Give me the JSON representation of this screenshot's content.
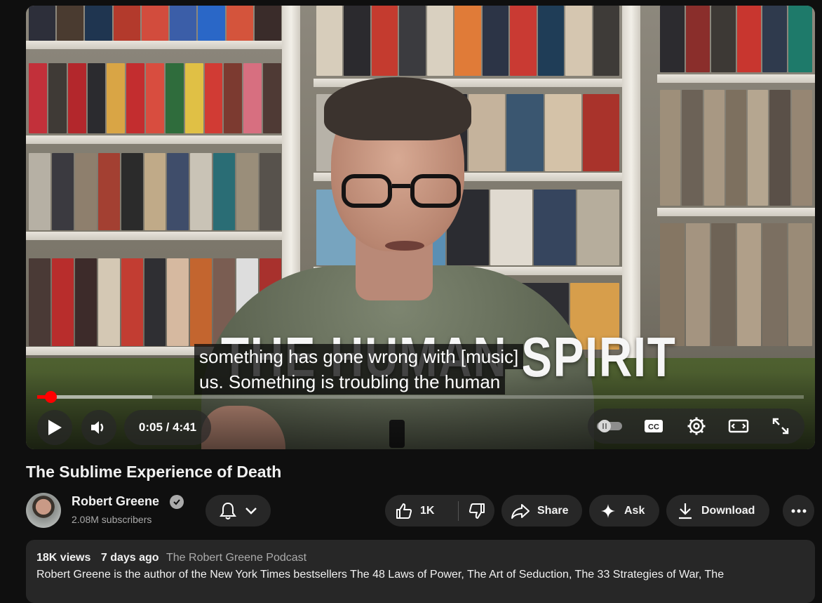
{
  "player": {
    "overlay_title": "THE HUMAN SPIRIT",
    "captions": [
      "something has gone wrong with [music]",
      "us. Something is troubling the human"
    ],
    "time_display": "0:05 / 4:41",
    "progress_fraction": 0.017,
    "buffered_fraction": 0.15,
    "icons": {
      "play": "play-icon",
      "volume": "volume-icon",
      "autoplay": "autoplay-toggle-icon",
      "cc": "cc-icon",
      "settings": "gear-icon",
      "theater": "theater-mode-icon",
      "fullscreen": "fullscreen-icon"
    },
    "cc_label": "CC"
  },
  "video": {
    "title": "The Sublime Experience of Death"
  },
  "channel": {
    "name": "Robert Greene",
    "subscribers": "2.08M subscribers",
    "verified_icon": "verified-check-icon"
  },
  "actions": {
    "like_count": "1K",
    "share_label": "Share",
    "ask_label": "Ask",
    "download_label": "Download"
  },
  "description": {
    "views": "18K views",
    "age": "7 days ago",
    "playlist": "The Robert Greene Podcast",
    "text": "Robert Greene is the author of the New York Times bestsellers The 48 Laws of Power, The Art of Seduction, The 33 Strategies of War, The"
  },
  "colors": {
    "background": "#0f0f0f",
    "surface": "#272727",
    "accent_red": "#ff0000",
    "secondary_text": "#aaaaaa"
  }
}
